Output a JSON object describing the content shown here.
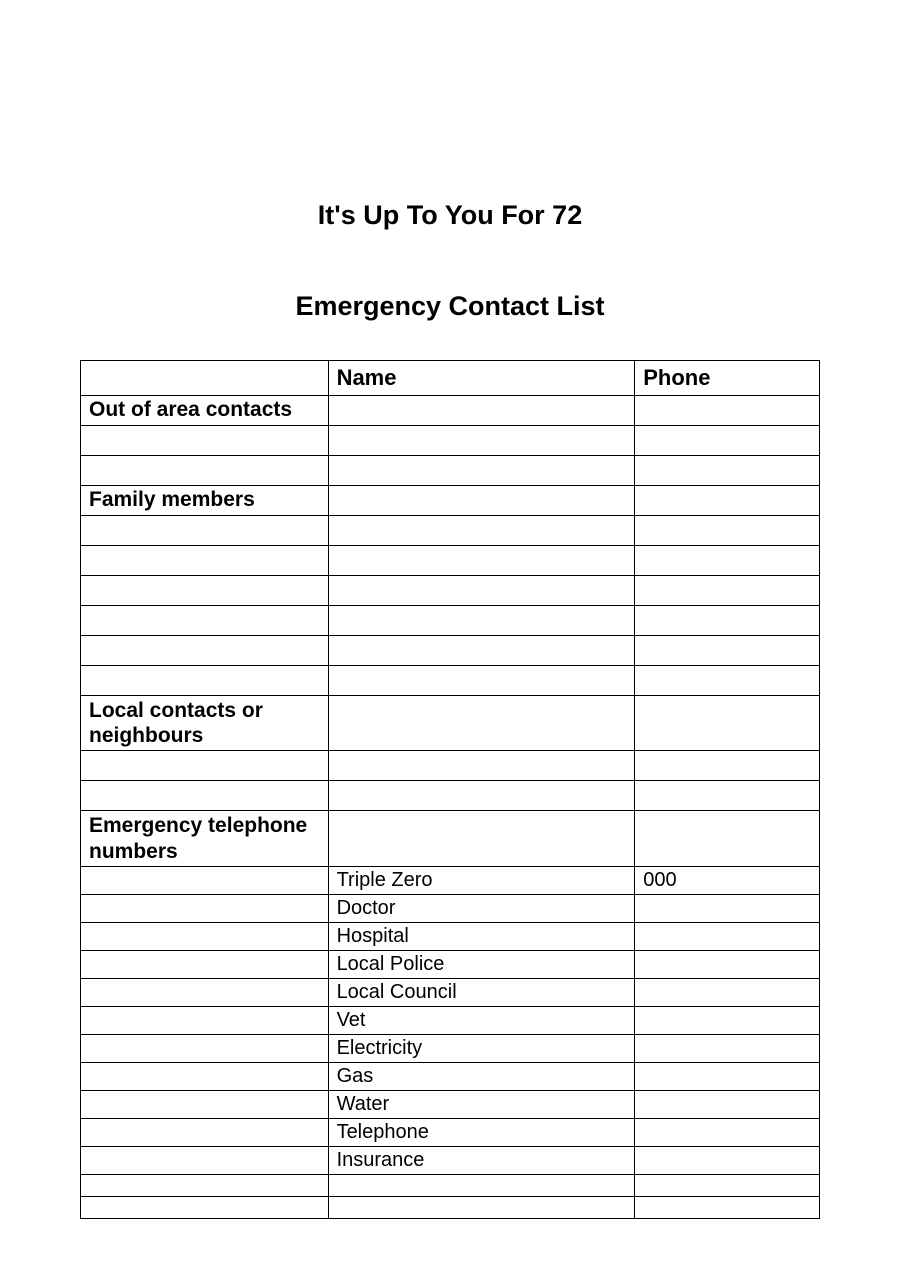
{
  "title1": "It's Up To You For 72",
  "title2": "Emergency Contact List",
  "headers": {
    "label": "",
    "name": "Name",
    "phone": "Phone"
  },
  "rows": [
    {
      "label": "Out of area contacts",
      "name": "",
      "phone": "",
      "bold": true,
      "tall": true
    },
    {
      "label": "",
      "name": "",
      "phone": "",
      "bold": false,
      "tall": true
    },
    {
      "label": "",
      "name": "",
      "phone": "",
      "bold": false,
      "tall": true
    },
    {
      "label": "Family members",
      "name": "",
      "phone": "",
      "bold": true,
      "tall": true
    },
    {
      "label": "",
      "name": "",
      "phone": "",
      "bold": false,
      "tall": true
    },
    {
      "label": "",
      "name": "",
      "phone": "",
      "bold": false,
      "tall": true
    },
    {
      "label": "",
      "name": "",
      "phone": "",
      "bold": false,
      "tall": true
    },
    {
      "label": "",
      "name": "",
      "phone": "",
      "bold": false,
      "tall": true
    },
    {
      "label": "",
      "name": "",
      "phone": "",
      "bold": false,
      "tall": true
    },
    {
      "label": "",
      "name": "",
      "phone": "",
      "bold": false,
      "tall": true
    },
    {
      "label": "Local contacts or neighbours",
      "name": "",
      "phone": "",
      "bold": true,
      "tall": true,
      "multiline": true
    },
    {
      "label": "",
      "name": "",
      "phone": "",
      "bold": false,
      "tall": true
    },
    {
      "label": "",
      "name": "",
      "phone": "",
      "bold": false,
      "tall": true
    },
    {
      "label": "Emergency telephone numbers",
      "name": "",
      "phone": "",
      "bold": true,
      "tall": true,
      "multiline": true
    },
    {
      "label": "",
      "name": "Triple Zero",
      "phone": "000",
      "bold": false
    },
    {
      "label": "",
      "name": "Doctor",
      "phone": "",
      "bold": false
    },
    {
      "label": "",
      "name": "Hospital",
      "phone": "",
      "bold": false
    },
    {
      "label": "",
      "name": "Local Police",
      "phone": "",
      "bold": false
    },
    {
      "label": "",
      "name": "Local Council",
      "phone": "",
      "bold": false
    },
    {
      "label": "",
      "name": "Vet",
      "phone": "",
      "bold": false
    },
    {
      "label": "",
      "name": "Electricity",
      "phone": "",
      "bold": false
    },
    {
      "label": "",
      "name": "Gas",
      "phone": "",
      "bold": false
    },
    {
      "label": "",
      "name": "Water",
      "phone": "",
      "bold": false
    },
    {
      "label": "",
      "name": "Telephone",
      "phone": "",
      "bold": false
    },
    {
      "label": "",
      "name": "Insurance",
      "phone": "",
      "bold": false
    },
    {
      "label": "",
      "name": "",
      "phone": "",
      "bold": false
    },
    {
      "label": "",
      "name": "",
      "phone": "",
      "bold": false
    }
  ]
}
